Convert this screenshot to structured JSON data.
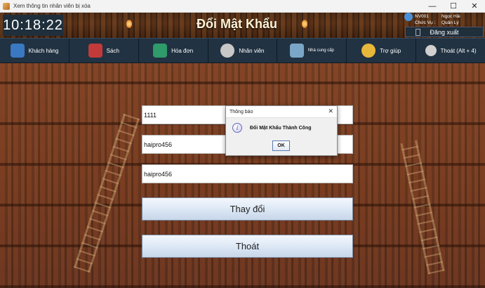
{
  "window": {
    "title": "Xem thông tin nhân viên bị xóa",
    "minimize_glyph": "—",
    "maximize_glyph": "☐",
    "close_glyph": "✕"
  },
  "header": {
    "clock": "10:18:22",
    "page_title": "Đổi Mật Khẩu",
    "user": {
      "id": "NV001",
      "name": "Ngọc Hải",
      "role_label": "Chức Vụ :",
      "role": "Quản Lý",
      "logout_label": "Đăng xuất"
    }
  },
  "nav": {
    "items": [
      {
        "label": "Khách hàng",
        "icon": "customer-icon",
        "color": "#3a78c2"
      },
      {
        "label": "Sách",
        "icon": "book-icon",
        "color": "#c23a3a"
      },
      {
        "label": "Hóa đơn",
        "icon": "invoice-icon",
        "color": "#2f9a6a"
      },
      {
        "label": "Nhân viên",
        "icon": "employee-icon",
        "color": "#c8c8c8"
      },
      {
        "label": "Nhà cung cấp",
        "icon": "supplier-icon",
        "color": "#7aa7c7"
      },
      {
        "label": "Trợ giúp",
        "icon": "help-icon",
        "color": "#e8b83a"
      },
      {
        "label": "Thoát (Alt + 4)",
        "icon": "exit-icon",
        "color": "#d0d0d0"
      }
    ]
  },
  "form": {
    "field1_value": "1111",
    "field2_value": "haipro456",
    "field3_value": "haipro456",
    "change_button": "Thay đổi",
    "exit_button": "Thoát"
  },
  "dialog": {
    "title": "Thông báo",
    "close_glyph": "✕",
    "icon_glyph": "i",
    "message": "Đổi Mật Khẩu Thành Công",
    "ok_label": "OK"
  }
}
